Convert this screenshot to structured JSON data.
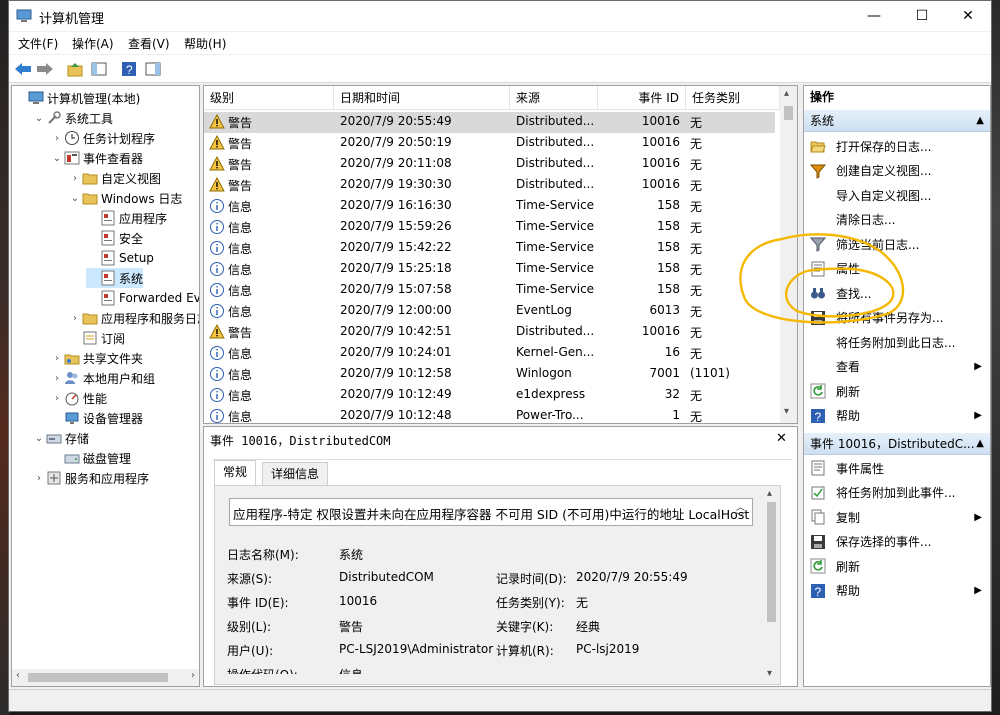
{
  "window": {
    "title": "计算机管理",
    "min_glyph": "—",
    "max_glyph": "☐",
    "close_glyph": "✕"
  },
  "menu": [
    "文件(F)",
    "操作(A)",
    "查看(V)",
    "帮助(H)"
  ],
  "tree": [
    {
      "label": "计算机管理(本地)",
      "level": 0,
      "icon": "computer-icon",
      "tw": ""
    },
    {
      "label": "系统工具",
      "level": 1,
      "icon": "tools-icon",
      "tw": "⌄"
    },
    {
      "label": "任务计划程序",
      "level": 2,
      "icon": "clock-icon",
      "tw": "›"
    },
    {
      "label": "事件查看器",
      "level": 2,
      "icon": "event-viewer-icon",
      "tw": "⌄"
    },
    {
      "label": "自定义视图",
      "level": 3,
      "icon": "folder-icon",
      "tw": "›"
    },
    {
      "label": "Windows 日志",
      "level": 3,
      "icon": "folder-icon",
      "tw": "⌄"
    },
    {
      "label": "应用程序",
      "level": 4,
      "icon": "log-icon",
      "tw": ""
    },
    {
      "label": "安全",
      "level": 4,
      "icon": "log-icon",
      "tw": ""
    },
    {
      "label": "Setup",
      "level": 4,
      "icon": "log-icon",
      "tw": ""
    },
    {
      "label": "系统",
      "level": 4,
      "icon": "log-icon",
      "tw": "",
      "selected": true
    },
    {
      "label": "Forwarded Eve",
      "level": 4,
      "icon": "log-icon",
      "tw": ""
    },
    {
      "label": "应用程序和服务日志",
      "level": 3,
      "icon": "folder-icon",
      "tw": "›"
    },
    {
      "label": "订阅",
      "level": 3,
      "icon": "subscription-icon",
      "tw": ""
    },
    {
      "label": "共享文件夹",
      "level": 2,
      "icon": "shared-folder-icon",
      "tw": "›"
    },
    {
      "label": "本地用户和组",
      "level": 2,
      "icon": "users-icon",
      "tw": "›"
    },
    {
      "label": "性能",
      "level": 2,
      "icon": "performance-icon",
      "tw": "›"
    },
    {
      "label": "设备管理器",
      "level": 2,
      "icon": "device-manager-icon",
      "tw": ""
    },
    {
      "label": "存储",
      "level": 1,
      "icon": "storage-icon",
      "tw": "⌄"
    },
    {
      "label": "磁盘管理",
      "level": 2,
      "icon": "disk-icon",
      "tw": ""
    },
    {
      "label": "服务和应用程序",
      "level": 1,
      "icon": "services-icon",
      "tw": "›"
    }
  ],
  "events": {
    "columns": [
      "级别",
      "日期和时间",
      "来源",
      "事件 ID",
      "任务类别"
    ],
    "rows": [
      {
        "level": "警告",
        "type": "warning",
        "datetime": "2020/7/9 20:55:49",
        "source": "Distributed...",
        "id": "10016",
        "task": "无",
        "selected": true
      },
      {
        "level": "警告",
        "type": "warning",
        "datetime": "2020/7/9 20:50:19",
        "source": "Distributed...",
        "id": "10016",
        "task": "无"
      },
      {
        "level": "警告",
        "type": "warning",
        "datetime": "2020/7/9 20:11:08",
        "source": "Distributed...",
        "id": "10016",
        "task": "无"
      },
      {
        "level": "警告",
        "type": "warning",
        "datetime": "2020/7/9 19:30:30",
        "source": "Distributed...",
        "id": "10016",
        "task": "无"
      },
      {
        "level": "信息",
        "type": "info",
        "datetime": "2020/7/9 16:16:30",
        "source": "Time-Service",
        "id": "158",
        "task": "无"
      },
      {
        "level": "信息",
        "type": "info",
        "datetime": "2020/7/9 15:59:26",
        "source": "Time-Service",
        "id": "158",
        "task": "无"
      },
      {
        "level": "信息",
        "type": "info",
        "datetime": "2020/7/9 15:42:22",
        "source": "Time-Service",
        "id": "158",
        "task": "无"
      },
      {
        "level": "信息",
        "type": "info",
        "datetime": "2020/7/9 15:25:18",
        "source": "Time-Service",
        "id": "158",
        "task": "无"
      },
      {
        "level": "信息",
        "type": "info",
        "datetime": "2020/7/9 15:07:58",
        "source": "Time-Service",
        "id": "158",
        "task": "无"
      },
      {
        "level": "信息",
        "type": "info",
        "datetime": "2020/7/9 12:00:00",
        "source": "EventLog",
        "id": "6013",
        "task": "无"
      },
      {
        "level": "警告",
        "type": "warning",
        "datetime": "2020/7/9 10:42:51",
        "source": "Distributed...",
        "id": "10016",
        "task": "无"
      },
      {
        "level": "信息",
        "type": "info",
        "datetime": "2020/7/9 10:24:01",
        "source": "Kernel-Gen...",
        "id": "16",
        "task": "无"
      },
      {
        "level": "信息",
        "type": "info",
        "datetime": "2020/7/9 10:12:58",
        "source": "Winlogon",
        "id": "7001",
        "task": "(1101)"
      },
      {
        "level": "信息",
        "type": "info",
        "datetime": "2020/7/9 10:12:49",
        "source": "e1dexpress",
        "id": "32",
        "task": "无"
      },
      {
        "level": "信息",
        "type": "info",
        "datetime": "2020/7/9 10:12:48",
        "source": "Power-Tro...",
        "id": "1",
        "task": "无"
      }
    ]
  },
  "detail": {
    "header": "事件 10016，DistributedCOM",
    "tabs": [
      "常规",
      "详细信息"
    ],
    "description": "应用程序-特定 权限设置并未向在应用程序容器 不可用 SID (不可用)中运行的地址 LocalHost",
    "fields": {
      "log_name_label": "日志名称(M):",
      "log_name": "系统",
      "source_label": "来源(S):",
      "source": "DistributedCOM",
      "logged_label": "记录时间(D):",
      "logged": "2020/7/9 20:55:49",
      "event_id_label": "事件 ID(E):",
      "event_id": "10016",
      "task_label": "任务类别(Y):",
      "task": "无",
      "level_label": "级别(L):",
      "level": "警告",
      "keywords_label": "关键字(K):",
      "keywords": "经典",
      "user_label": "用户(U):",
      "user": "PC-LSJ2019\\Administrator",
      "computer_label": "计算机(R):",
      "computer": "PC-lsj2019",
      "opcode_label": "操作代码(O):",
      "opcode": "信息"
    }
  },
  "actions": {
    "header": "操作",
    "section1": "系统",
    "items1": [
      {
        "label": "打开保存的日志...",
        "icon": "open-folder-icon"
      },
      {
        "label": "创建自定义视图...",
        "icon": "filter-create-icon"
      },
      {
        "label": "导入自定义视图...",
        "icon": "none"
      },
      {
        "label": "清除日志...",
        "icon": "none"
      },
      {
        "label": "筛选当前日志...",
        "icon": "filter-icon"
      },
      {
        "label": "属性",
        "icon": "properties-icon"
      },
      {
        "label": "查找...",
        "icon": "binoculars-icon"
      },
      {
        "label": "将所有事件另存为...",
        "icon": "save-icon"
      },
      {
        "label": "将任务附加到此日志...",
        "icon": "none"
      },
      {
        "label": "查看",
        "icon": "none",
        "submenu": true
      },
      {
        "label": "刷新",
        "icon": "refresh-icon"
      },
      {
        "label": "帮助",
        "icon": "help-icon",
        "submenu": true
      }
    ],
    "section2": "事件 10016，DistributedC...",
    "items2": [
      {
        "label": "事件属性",
        "icon": "properties-icon"
      },
      {
        "label": "将任务附加到此事件...",
        "icon": "task-icon"
      },
      {
        "label": "复制",
        "icon": "copy-icon",
        "submenu": true
      },
      {
        "label": "保存选择的事件...",
        "icon": "save-icon"
      },
      {
        "label": "刷新",
        "icon": "refresh-icon"
      },
      {
        "label": "帮助",
        "icon": "help-icon",
        "submenu": true
      }
    ]
  },
  "colors": {
    "selection": "#cce8ff",
    "row_selected": "#d9d9d9",
    "annotation": "#f5b800"
  }
}
